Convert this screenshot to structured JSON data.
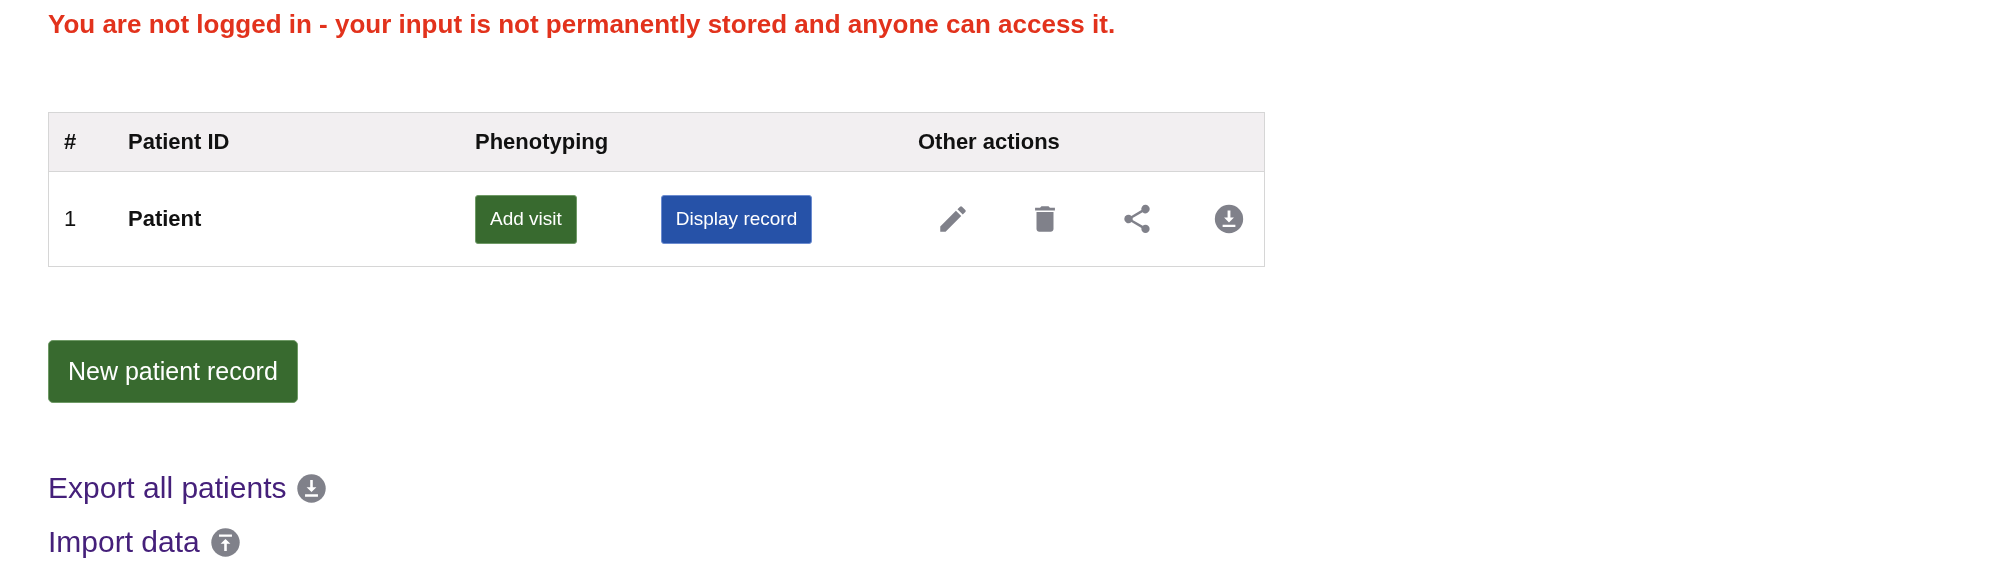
{
  "warning": "You are not logged in - your input is not permanently stored and anyone can access it.",
  "table": {
    "columns": [
      "#",
      "Patient ID",
      "Phenotyping",
      "Other actions"
    ],
    "rows": [
      {
        "number": "1",
        "patient_id": "Patient",
        "phenotyping": [
          "Add visit",
          "Display record"
        ]
      }
    ]
  },
  "new_button": "New patient record",
  "links": [
    {
      "label": "Export all patients",
      "kind": "export"
    },
    {
      "label": "Import data",
      "kind": "import"
    }
  ]
}
